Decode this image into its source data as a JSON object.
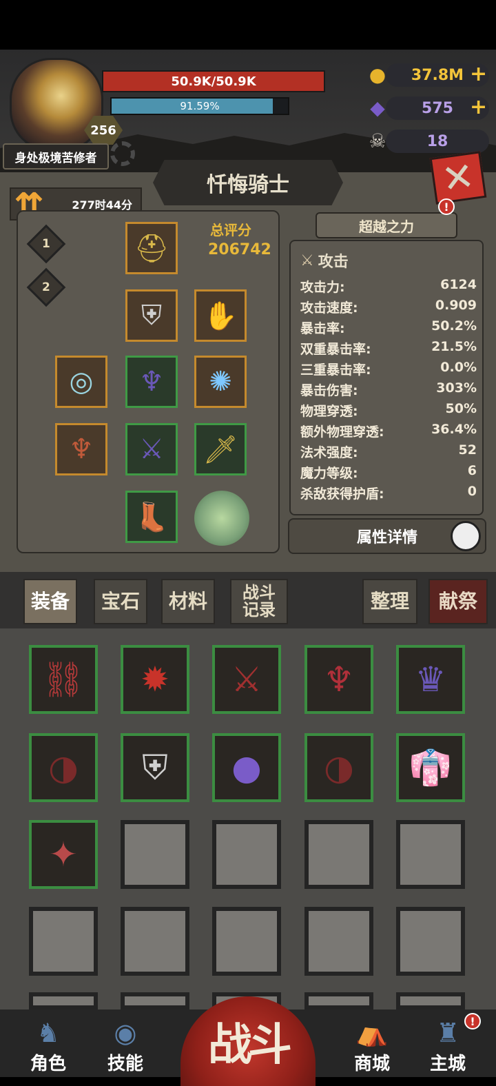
{
  "player": {
    "name": "身处极境苦修者",
    "level": "256",
    "hp_text": "50.9K/50.9K",
    "xp_text": "91.59%",
    "xp_fraction": 0.9159
  },
  "resources": {
    "gold": "37.8M",
    "crystal": "575",
    "ram": "18"
  },
  "class_title": "忏悔骑士",
  "timer": "277时44分",
  "loadout_slots": [
    "1",
    "2"
  ],
  "score": {
    "label": "总评分",
    "value": "206742"
  },
  "transcend_label": "超越之力",
  "stats": {
    "header": "攻击",
    "rows": [
      {
        "label": "攻击力:",
        "value": "6124"
      },
      {
        "label": "攻击速度:",
        "value": "0.909"
      },
      {
        "label": "暴击率:",
        "value": "50.2%"
      },
      {
        "label": "双重暴击率:",
        "value": "21.5%"
      },
      {
        "label": "三重暴击率:",
        "value": "0.0%"
      },
      {
        "label": "暴击伤害:",
        "value": "303%"
      },
      {
        "label": "物理穿透:",
        "value": "50%"
      },
      {
        "label": "额外物理穿透:",
        "value": "36.4%"
      },
      {
        "label": "法术强度:",
        "value": "52"
      },
      {
        "label": "魔力等级:",
        "value": "6"
      },
      {
        "label": "杀敌获得护盾:",
        "value": "0"
      }
    ]
  },
  "attr_detail_label": "属性详情",
  "tabs": {
    "equip": "装备",
    "gem": "宝石",
    "material": "材料",
    "battle_log": "战斗记录",
    "sort": "整理",
    "sacrifice": "献祭"
  },
  "nav": {
    "role": "角色",
    "skill": "技能",
    "fight": "战斗",
    "shop": "商城",
    "city": "主城"
  },
  "alert_mark": "!"
}
